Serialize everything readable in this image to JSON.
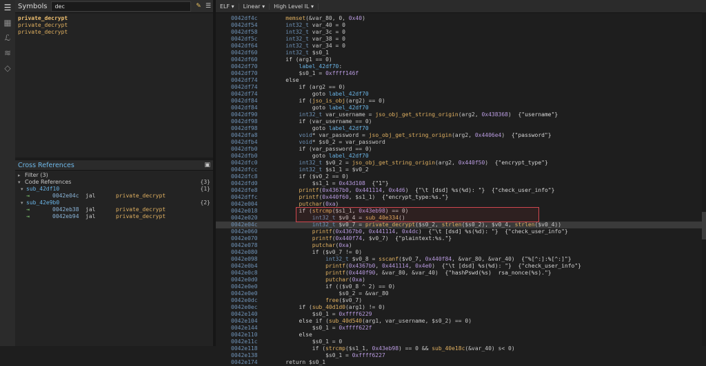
{
  "sidebar_icons": [
    "symbols-icon",
    "types-icon",
    "lambda-icon",
    "stack-icon",
    "tags-icon"
  ],
  "symbols": {
    "title": "Symbols",
    "search_value": "dec",
    "items": [
      {
        "label": "private_decrypt",
        "bold": true
      },
      {
        "label": "private_decrypt",
        "bold": false
      },
      {
        "label": "private_decrypt",
        "bold": false
      }
    ]
  },
  "xrefs": {
    "title": "Cross References",
    "filter_label": "Filter (3)",
    "code_refs_label": "Code References",
    "code_refs_count": "{3}",
    "groups": [
      {
        "name": "sub_42df10",
        "count": "{1}",
        "refs": [
          {
            "addr": "0042e04c",
            "ins": "jal",
            "target": "private_decrypt"
          }
        ]
      },
      {
        "name": "sub_42e9b0",
        "count": "{2}",
        "refs": [
          {
            "addr": "0042eb38",
            "ins": "jal",
            "target": "private_decrypt"
          },
          {
            "addr": "0042eb94",
            "ins": "jal",
            "target": "private_decrypt"
          }
        ]
      }
    ]
  },
  "toolbar": {
    "view": "ELF ▾",
    "mode": "Linear ▾",
    "il": "High Level IL ▾"
  },
  "code": [
    {
      "a": "0042df4c",
      "t": "    memset(&var_80, 0, 0x40)"
    },
    {
      "a": "0042df54",
      "t": "    int32_t var_40 = 0"
    },
    {
      "a": "0042df58",
      "t": "    int32_t var_3c = 0"
    },
    {
      "a": "0042df5c",
      "t": "    int32_t var_38 = 0"
    },
    {
      "a": "0042df64",
      "t": "    int32_t var_34 = 0"
    },
    {
      "a": "0042df60",
      "t": "    int32_t $s0_1"
    },
    {
      "a": "0042df60",
      "t": "    if (arg1 == 0)"
    },
    {
      "a": "0042df70",
      "t": "        label_42df70:"
    },
    {
      "a": "0042df70",
      "t": "        $s0_1 = 0xffff146f"
    },
    {
      "a": "0042df74",
      "t": "    else"
    },
    {
      "a": "0042df74",
      "t": "        if (arg2 == 0)"
    },
    {
      "a": "0042df74",
      "t": "            goto label_42df70"
    },
    {
      "a": "0042df84",
      "t": "        if (jso_is_obj(arg2) == 0)"
    },
    {
      "a": "0042df84",
      "t": "            goto label_42df70"
    },
    {
      "a": "0042df90",
      "t": "        int32_t var_username = jso_obj_get_string_origin(arg2, 0x438368)  {\"username\"}"
    },
    {
      "a": "0042df98",
      "t": "        if (var_username == 0)"
    },
    {
      "a": "0042df98",
      "t": "            goto label_42df70"
    },
    {
      "a": "0042dfa8",
      "t": "        void* var_password = jso_obj_get_string_origin(arg2, 0x4406e4)  {\"password\"}"
    },
    {
      "a": "0042dfb4",
      "t": "        void* $s0_2 = var_password"
    },
    {
      "a": "0042dfb0",
      "t": "        if (var_password == 0)"
    },
    {
      "a": "0042dfb0",
      "t": "            goto label_42df70"
    },
    {
      "a": "0042dfc0",
      "t": "        int32_t $v0_2 = jso_obj_get_string_origin(arg2, 0x440f50)  {\"encrypt_type\"}"
    },
    {
      "a": "0042dfcc",
      "t": "        int32_t $s1_1 = $v0_2"
    },
    {
      "a": "0042dfc8",
      "t": "        if ($v0_2 == 0)"
    },
    {
      "a": "0042dfd0",
      "t": "            $s1_1 = 0x43d108  {\"1\"}"
    },
    {
      "a": "0042dfe8",
      "t": "        printf(0x4367b0, 0x441114, 0x4d6)  {\"\\t [dsd] %s(%d): \"}  {\"check_user_info\"}"
    },
    {
      "a": "0042dffc",
      "t": "        printf(0x440f60, $s1_1)  {\"encrypt_type:%s.\"}"
    },
    {
      "a": "0042e004",
      "t": "        putchar(0xa)"
    },
    {
      "a": "0042e018",
      "t": "        if (strcmp($s1_1, 0x43eb98) == 0)"
    },
    {
      "a": "0042e020",
      "t": "            int32_t $v0_4 = sub_40e334()"
    },
    {
      "a": "0042e04c",
      "t": "            int32_t $v0_7 = private_decrypt($s0_2, strlen($s0_2), $v0_4, strlen($v0_4))",
      "sel": true
    },
    {
      "a": "0042e060",
      "t": "            printf(0x4367b0, 0x441114, 0x4dc)  {\"\\t [dsd] %s(%d): \"}  {\"check_user_info\"}"
    },
    {
      "a": "0042e070",
      "t": "            printf(0x440f74, $v0_7)  {\"plaintext:%s.\"}"
    },
    {
      "a": "0042e078",
      "t": "            putchar(0xa)"
    },
    {
      "a": "0042e080",
      "t": "            if ($v0_7 != 0)"
    },
    {
      "a": "0042e098",
      "t": "                int32_t $v0_8 = sscanf($v0_7, 0x440f84, &var_80, &var_40)  {\"%[^:]:%[^:]\"}"
    },
    {
      "a": "0042e0b4",
      "t": "                printf(0x4367b0, 0x441114, 0x4e0)  {\"\\t [dsd] %s(%d): \"}  {\"check_user_info\"}"
    },
    {
      "a": "0042e0c8",
      "t": "                printf(0x440f90, &var_80, &var_40)  {\"hashPswd(%s)  rsa_nonce(%s).\"}"
    },
    {
      "a": "0042e0d0",
      "t": "                putchar(0xa)"
    },
    {
      "a": "0042e0e0",
      "t": "                if (($v0_8 ^ 2) == 0)"
    },
    {
      "a": "0042e0e0",
      "t": "                    $s0_2 = &var_80"
    },
    {
      "a": "0042e0dc",
      "t": "                free($v0_7)"
    },
    {
      "a": "0042e0ec",
      "t": "        if (sub_40d1d0(arg1) != 0)"
    },
    {
      "a": "0042e140",
      "t": "            $s0_1 = 0xffff6229"
    },
    {
      "a": "0042e104",
      "t": "        else if (sub_40d540(arg1, var_username, $s0_2) == 0)"
    },
    {
      "a": "0042e144",
      "t": "            $s0_1 = 0xffff622f"
    },
    {
      "a": "0042e110",
      "t": "        else"
    },
    {
      "a": "0042e11c",
      "t": "            $s0_1 = 0"
    },
    {
      "a": "0042e118",
      "t": "            if (strcmp($s1_1, 0x43eb98) == 0 && sub_40e18c(&var_40) s< 0)"
    },
    {
      "a": "0042e138",
      "t": "                $s0_1 = 0xffff6227"
    },
    {
      "a": "0042e174",
      "t": "    return $s0_1"
    }
  ],
  "colors": {
    "accent": "#6fb8e8",
    "symbol": "#e0b060",
    "highlight": "#d0474f"
  }
}
